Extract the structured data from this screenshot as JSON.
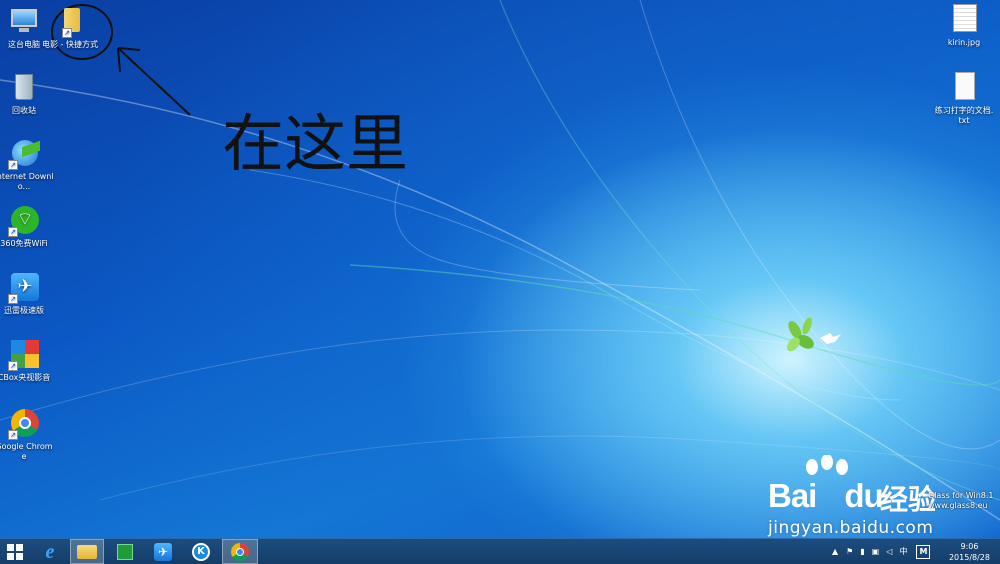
{
  "desktop": {
    "icons_left": [
      {
        "name": "this-pc",
        "label": "这台电脑"
      },
      {
        "name": "movie-shortcut",
        "label": "电影 - 快捷方式"
      },
      {
        "name": "recycle-bin",
        "label": "回收站"
      },
      {
        "name": "internet-download-manager",
        "label": "Internet Downlo..."
      },
      {
        "name": "360-free-wifi",
        "label": "360免费WiFi"
      },
      {
        "name": "xunlei-speed",
        "label": "迅雷极速版"
      },
      {
        "name": "cbox",
        "label": "CBox央视影音"
      },
      {
        "name": "google-chrome",
        "label": "Google Chrome"
      }
    ],
    "icons_right": [
      {
        "name": "kirin-jpg",
        "label": "kirin.jpg"
      },
      {
        "name": "typing-practice-txt",
        "label": "练习打字的文档.txt"
      }
    ],
    "annotation_text": "在这里"
  },
  "watermark": {
    "brand": "Bai",
    "brand_suffix": "du",
    "cn": "经验",
    "url": "jingyan.baidu.com",
    "glass_line1": "Glass for Win8.1",
    "glass_line2": "www.glass8.eu"
  },
  "taskbar": {
    "tray_lang": "中",
    "tray_ime": "M",
    "time": "9:06",
    "date": "2015/8/28"
  },
  "colors": {
    "taskbar": "#1c4d80",
    "desktop_blue": "#0b58c4"
  }
}
